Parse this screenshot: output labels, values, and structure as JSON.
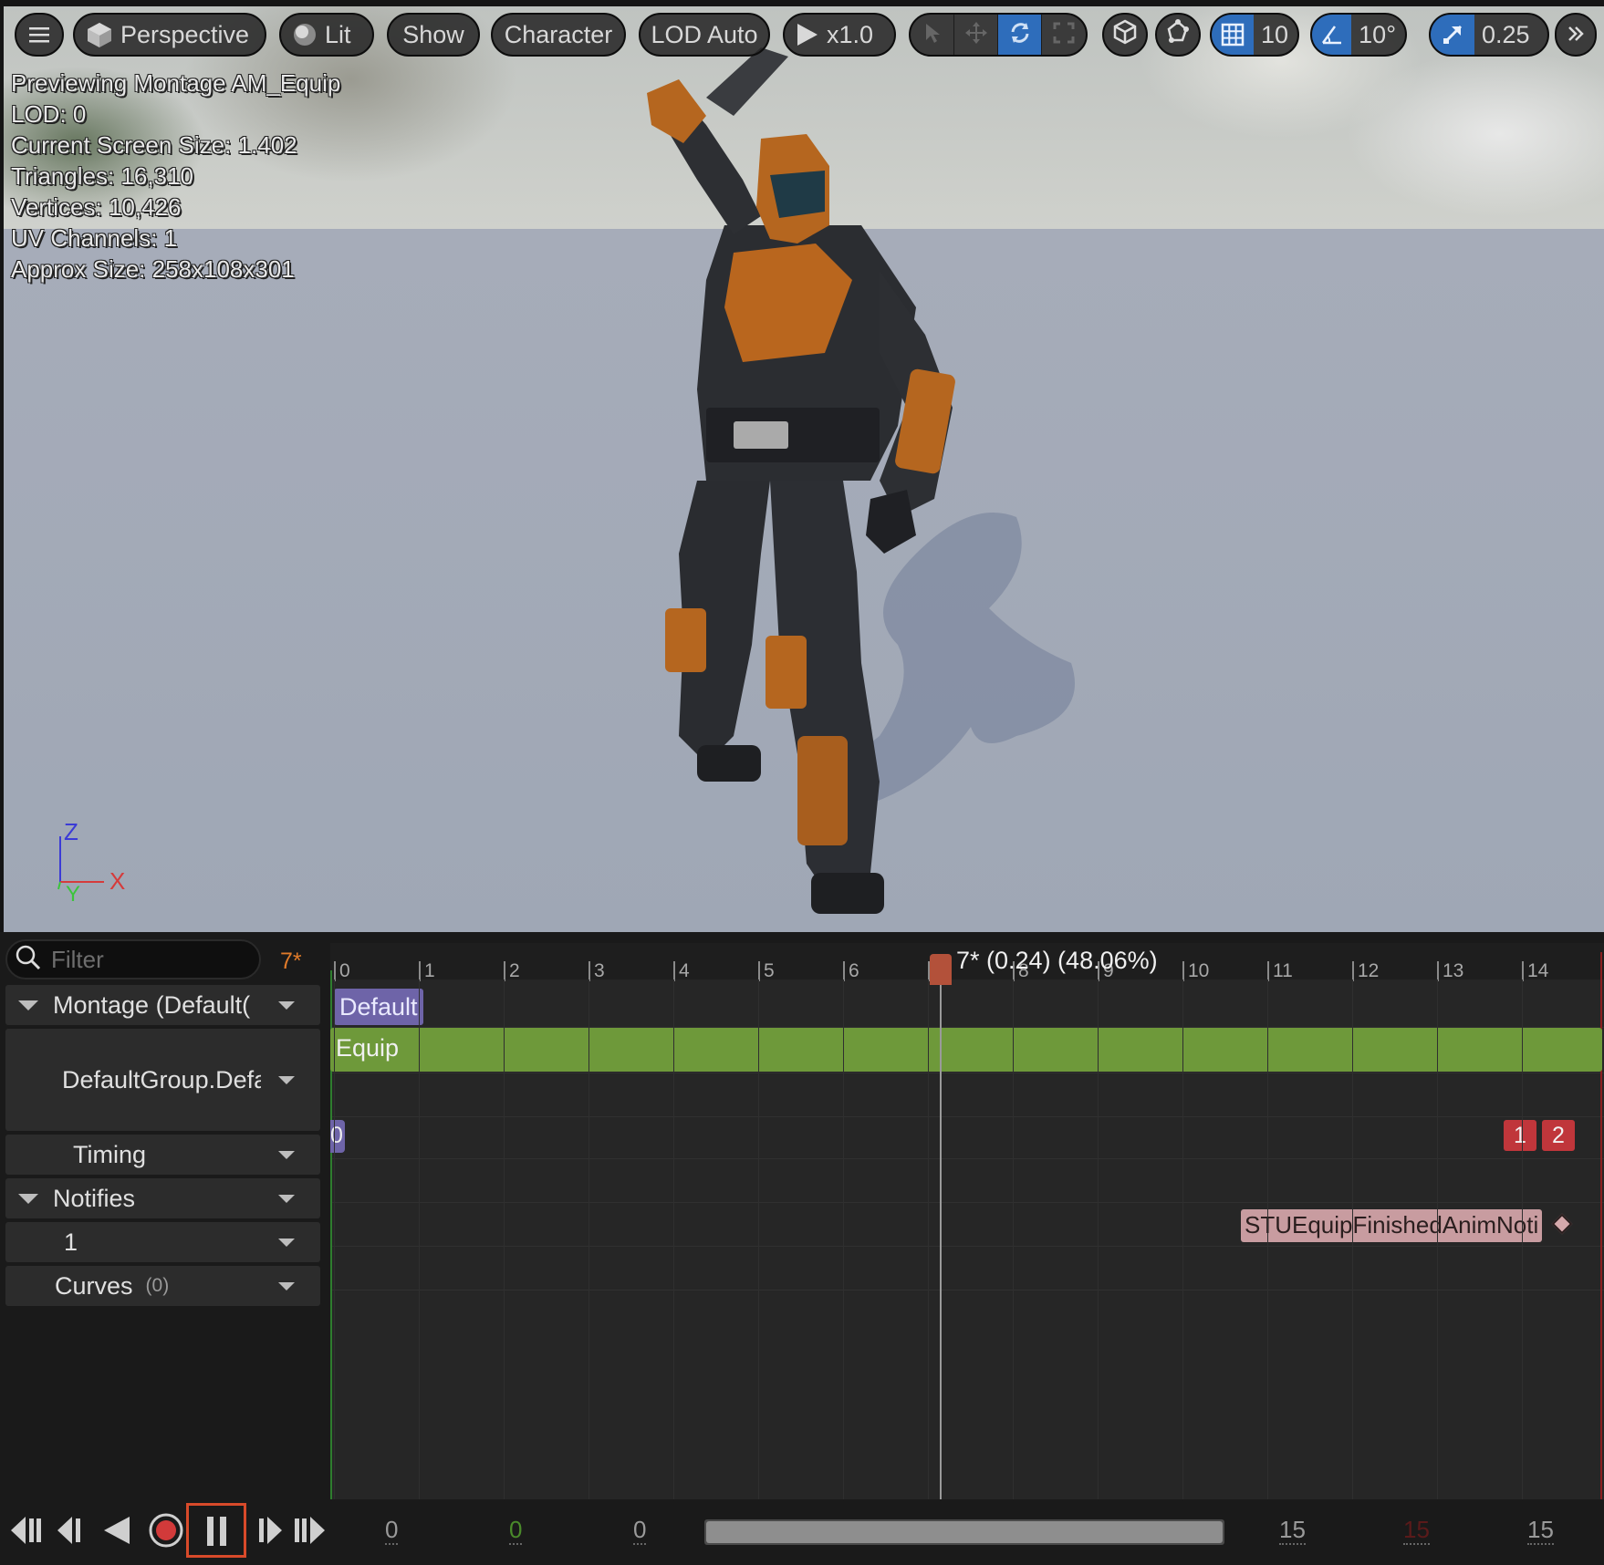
{
  "toolbar": {
    "view_mode": "Perspective",
    "lighting": "Lit",
    "show": "Show",
    "character": "Character",
    "lod": "LOD Auto",
    "play_speed": "x1.0",
    "grid_snap": "10",
    "rotation_snap": "10°",
    "scale_snap": "0.25"
  },
  "stats": {
    "line1": "Previewing Montage AM_Equip",
    "line2": "LOD: 0",
    "line3": "Current Screen Size: 1.402",
    "line4": "Triangles: 16,310",
    "line5": "Vertices: 10,426",
    "line6": "UV Channels: 1",
    "line7": "Approx Size: 258x108x301"
  },
  "axes": {
    "z": "Z",
    "x": "X",
    "y": "Y"
  },
  "panel": {
    "filter_placeholder": "Filter",
    "current_frame": "7*",
    "tracks": {
      "montage": "Montage (Default(",
      "group": "DefaultGroup.Defa",
      "timing": "Timing",
      "notifies": "Notifies",
      "notify_track": "1",
      "curves": "Curves",
      "curves_count": "(0)"
    }
  },
  "timeline": {
    "ticks": [
      "0",
      "1",
      "2",
      "3",
      "4",
      "5",
      "6",
      "7",
      "8",
      "9",
      "10",
      "11",
      "12",
      "13",
      "14"
    ],
    "playhead_label": "7* (0.24) (48.06%)",
    "playhead_frame": 7,
    "section": "Default",
    "segment": "Equip",
    "timing_start": "0",
    "timing_markers": [
      "1",
      "2"
    ],
    "notify": "STUEquipFinishedAnimNoti"
  },
  "transport": {
    "start": "0",
    "current": "0",
    "view_start": "0",
    "view_end": "15",
    "end_red": "15",
    "end": "15"
  },
  "colors": {
    "accent": "#2e6dbb",
    "segment_green": "#6e993a",
    "section_purple": "#6e64a8",
    "marker_red": "#c0363b",
    "notify_pink": "#c89ca0",
    "frame_orange": "#e07b2a"
  }
}
